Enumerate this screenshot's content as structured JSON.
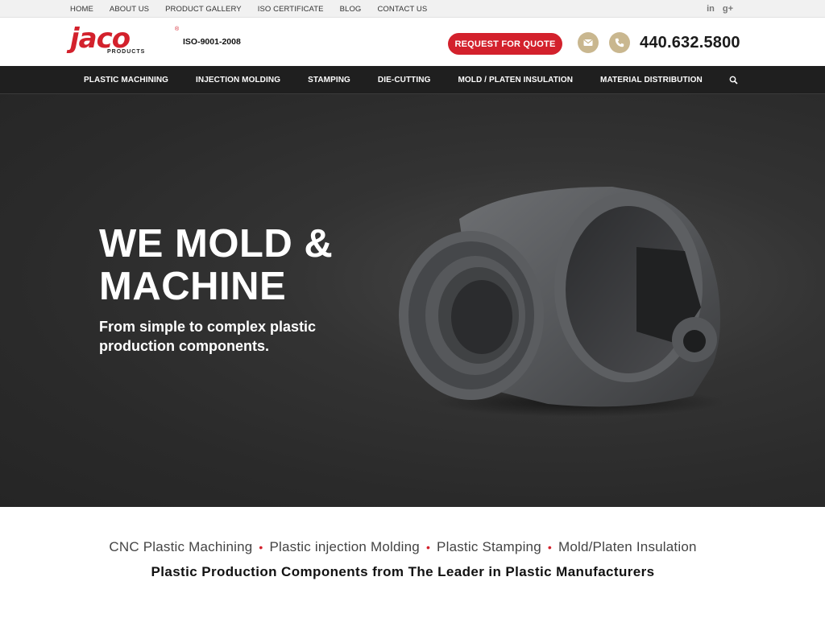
{
  "topbar": {
    "links": [
      "HOME",
      "ABOUT US",
      "PRODUCT GALLERY",
      "ISO CERTIFICATE",
      "BLOG",
      "CONTACT US"
    ],
    "social": [
      {
        "icon": "linkedin-icon",
        "glyph": "in"
      },
      {
        "icon": "google-plus-icon",
        "glyph": "g+"
      }
    ]
  },
  "header": {
    "logo_text": "jaco",
    "logo_sub": "PRODUCTS",
    "logo_reg": "®",
    "iso": "ISO-9001-2008",
    "quote_button": "REQUEST FOR QUOTE",
    "phone": "440.632.5800"
  },
  "nav": {
    "items": [
      "PLASTIC MACHINING",
      "INJECTION MOLDING",
      "STAMPING",
      "DIE-CUTTING",
      "MOLD / PLATEN INSULATION",
      "MATERIAL DISTRIBUTION"
    ]
  },
  "hero": {
    "heading_line1": "WE MOLD &",
    "heading_line2": "MACHINE",
    "subheading": "From simple to complex plastic production components."
  },
  "services": {
    "items": [
      "CNC Plastic Machining",
      "Plastic injection Molding",
      "Plastic Stamping",
      "Mold/Platen Insulation"
    ],
    "separator": "•",
    "subtitle": "Plastic Production Components from The Leader in Plastic Manufacturers"
  },
  "colors": {
    "brand_red": "#d3212c",
    "gold": "#c9b78f",
    "nav_bg": "#1f1f1f",
    "hero_bg": "#2a2a2a"
  }
}
